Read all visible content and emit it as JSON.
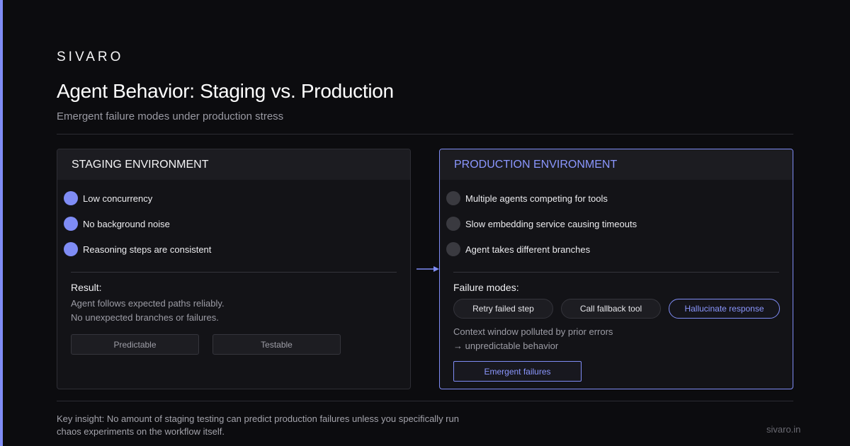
{
  "brand": "SIVARO",
  "title": "Agent Behavior: Staging vs. Production",
  "subtitle": "Emergent failure modes under production stress",
  "staging": {
    "header": "STAGING ENVIRONMENT",
    "items": [
      "Low concurrency",
      "No background noise",
      "Reasoning steps are consistent"
    ],
    "result_label": "Result:",
    "result_lines": [
      "Agent follows expected paths reliably.",
      "No unexpected branches or failures."
    ],
    "tags": [
      "Predictable",
      "Testable"
    ]
  },
  "production": {
    "header": "PRODUCTION ENVIRONMENT",
    "items": [
      "Multiple agents competing for tools",
      "Slow embedding service causing timeouts",
      "Agent takes different branches"
    ],
    "failure_label": "Failure modes:",
    "failure_modes": [
      "Retry failed step",
      "Call fallback tool",
      "Hallucinate response"
    ],
    "context_lines": [
      "Context window polluted by prior errors",
      "→ unpredictable behavior"
    ],
    "emergent_label": "Emergent failures"
  },
  "insight": "Key insight: No amount of staging testing can predict production failures unless you specifically run chaos experiments on the workflow itself.",
  "footer_url": "sivaro.in",
  "colors": {
    "accent": "#7f8cf5",
    "background": "#0c0c0f",
    "panel": "#131317"
  }
}
